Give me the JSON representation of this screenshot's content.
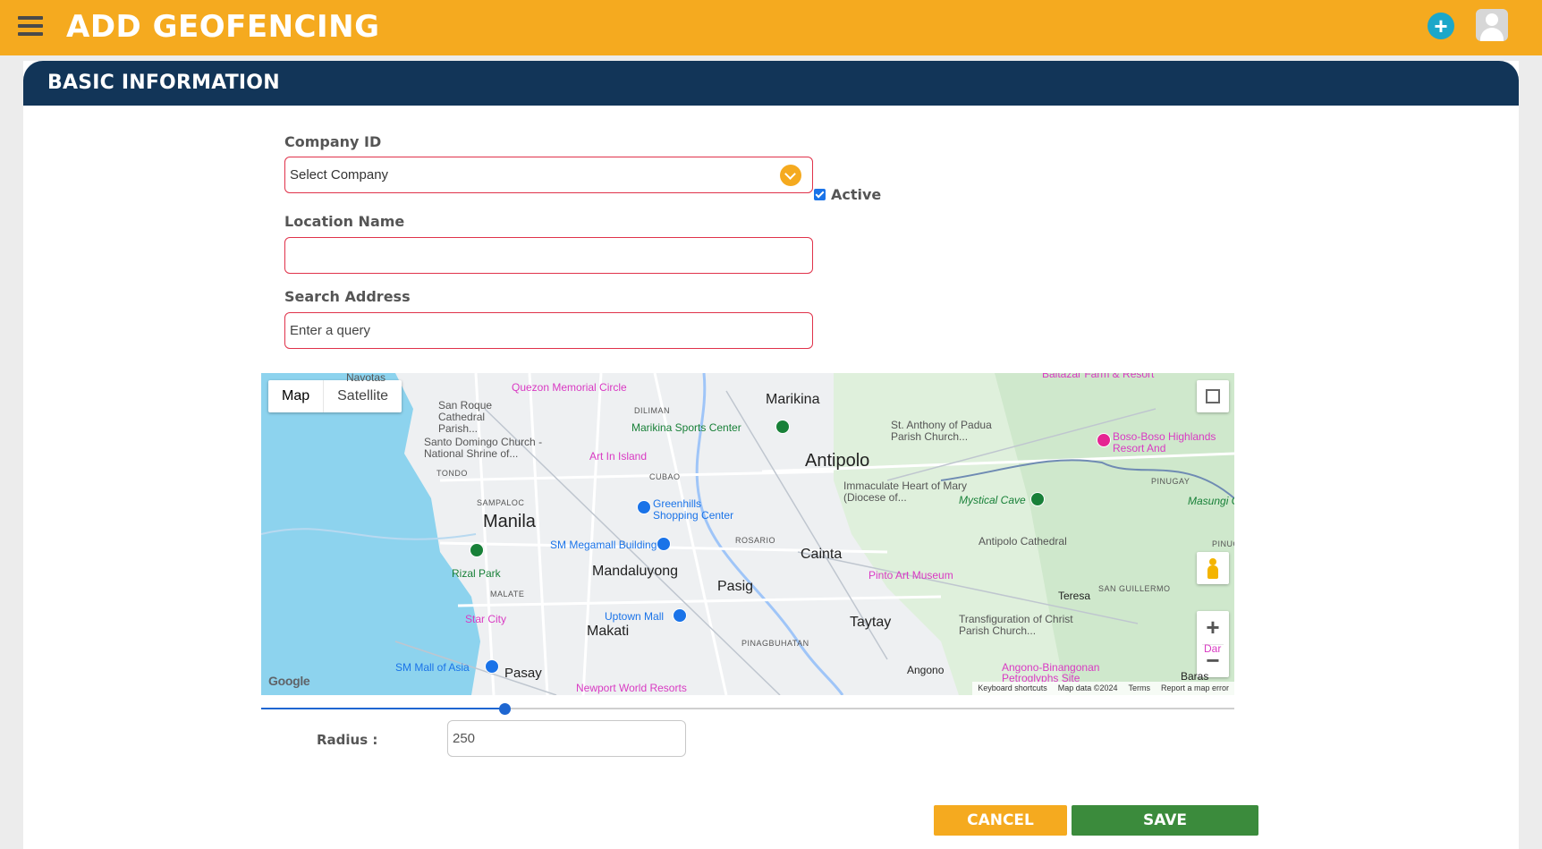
{
  "header": {
    "title": "ADD GEOFENCING",
    "menu_icon": "hamburger-menu-icon",
    "add_icon": "plus-circle-icon",
    "avatar_icon": "user-avatar-icon",
    "colors": {
      "topbar": "#f5aa1f",
      "card_header": "#123558"
    }
  },
  "section": {
    "title": "BASIC INFORMATION"
  },
  "form": {
    "company_label": "Company ID",
    "company_value": "Select Company",
    "location_label": "Location Name",
    "location_value": "",
    "active_label": "Active",
    "active_checked": true,
    "search_label": "Search Address",
    "search_placeholder": "Enter a query",
    "radius_label": "Radius :",
    "radius_value": "250",
    "radius_slider_fraction": 0.25
  },
  "map": {
    "type_map": "Map",
    "type_satellite": "Satellite",
    "zoom_in": "+",
    "zoom_out": "−",
    "google": "Google",
    "footer": {
      "shortcuts": "Keyboard shortcuts",
      "data": "Map data ©2024",
      "terms": "Terms",
      "report": "Report a map error"
    },
    "labels": {
      "marikina": "Marikina",
      "antipolo": "Antipolo",
      "manila": "Manila",
      "mandaluyong": "Mandaluyong",
      "pasig": "Pasig",
      "cainta": "Cainta",
      "taytay": "Taytay",
      "makati": "Makati",
      "pasay": "Pasay",
      "teresa": "Teresa",
      "angono": "Angono",
      "baras": "Baras",
      "navotas": "Navotas",
      "quezon_circle": "Quezon Memorial Circle",
      "san_roque": "San Roque Cathedral Parish...",
      "santo_domingo": "Santo Domingo Church - National Shrine of...",
      "marikina_sports": "Marikina Sports Center",
      "art_island": "Art In Island",
      "st_anthony": "St. Anthony of Padua Parish Church...",
      "boso_boso": "Boso-Boso Highlands Resort And",
      "immaculate": "Immaculate Heart of Mary (Diocese of...",
      "mystical_cave": "Mystical Cave",
      "greenhills": "Greenhills Shopping Center",
      "sm_megamall": "SM Megamall Building A",
      "antipolo_cathedral": "Antipolo Cathedral",
      "rizal_park": "Rizal Park",
      "pinto": "Pinto Art Museum",
      "uptown": "Uptown Mall",
      "star_city": "Star City",
      "transfiguration": "Transfiguration of Christ Parish Church...",
      "sm_asia": "SM Mall of Asia",
      "angono_petro": "Angono-Binangonan Petroglyphs Site",
      "newport": "Newport World Resorts",
      "masungi": "Masungi Geore",
      "baltazar": "Baltazar Farm & Resort",
      "diliman": "DILIMAN",
      "cubao": "CUBAO",
      "tondo": "TONDO",
      "sampaloc": "SAMPALOC",
      "rosario": "ROSARIO",
      "malate": "MALATE",
      "pinagbuhatan": "PINAGBUHATAN",
      "san_guillermo": "SAN GUILLERMO",
      "pinugay": "PINUGAY",
      "dar": "Dar"
    }
  },
  "buttons": {
    "cancel": "CANCEL",
    "save": "SAVE"
  }
}
